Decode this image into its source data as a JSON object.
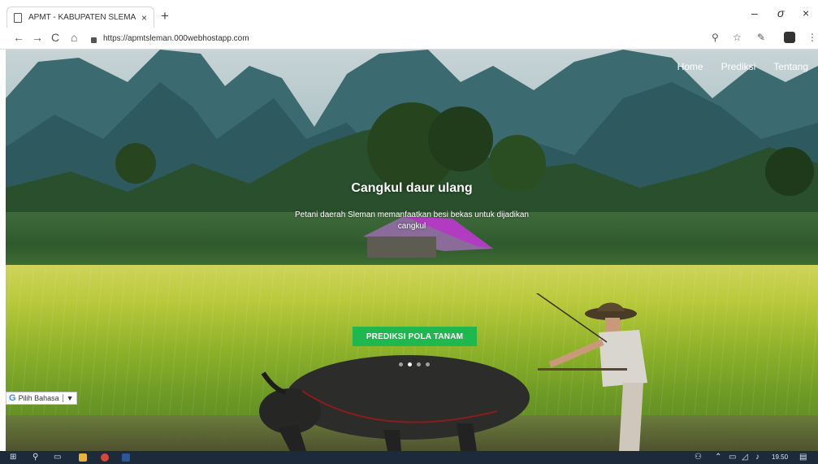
{
  "browser": {
    "tab_title": "APMT - KABUPATEN SLEMAN",
    "tab_close": "×",
    "new_tab": "+",
    "url": "https://apmtsleman.000webhostapp.com",
    "window_min": "–",
    "window_max": "σ",
    "window_close": "×"
  },
  "nav": {
    "home": "Home",
    "prediksi": "Prediksi",
    "tentang": "Tentang"
  },
  "hero": {
    "title": "Cangkul daur ulang",
    "subtitle": "Petani daerah Sleman memanfaatkan besi bekas untuk dijadikan cangkul",
    "cta": "PREDIKSI POLA TANAM",
    "slides": 4,
    "active_slide": 2
  },
  "language_widget": {
    "label": "Pilih Bahasa",
    "arrow": "▼"
  },
  "taskbar": {
    "clock": "19.50"
  },
  "colors": {
    "cta": "#1fb84f",
    "taskbar": "#1c2a3a"
  }
}
